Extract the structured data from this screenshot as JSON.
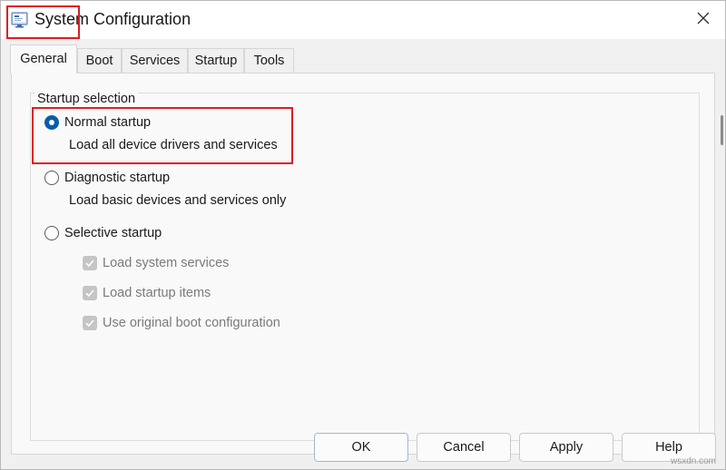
{
  "window": {
    "title": "System Configuration"
  },
  "tabs": [
    {
      "label": "General",
      "active": true
    },
    {
      "label": "Boot",
      "active": false
    },
    {
      "label": "Services",
      "active": false
    },
    {
      "label": "Startup",
      "active": false
    },
    {
      "label": "Tools",
      "active": false
    }
  ],
  "startup_selection": {
    "legend": "Startup selection",
    "normal": {
      "label": "Normal startup",
      "description": "Load all device drivers and services",
      "selected": true
    },
    "diagnostic": {
      "label": "Diagnostic startup",
      "description": "Load basic devices and services only",
      "selected": false
    },
    "selective": {
      "label": "Selective startup",
      "selected": false
    },
    "options": [
      {
        "label": "Load system services",
        "checked": true,
        "enabled": false
      },
      {
        "label": "Load startup items",
        "checked": true,
        "enabled": false
      },
      {
        "label": "Use original boot configuration",
        "checked": true,
        "enabled": false
      }
    ]
  },
  "buttons": {
    "ok": "OK",
    "cancel": "Cancel",
    "apply": "Apply",
    "help": "Help"
  },
  "watermark": "wsxdn.com",
  "colors": {
    "accent": "#0b5cad",
    "highlight": "#e01b22",
    "dialog_bg": "#f0f0f0",
    "panel_bg": "#f9f9f9"
  },
  "icons": {
    "app": "system-config-app-icon",
    "close": "close-icon",
    "check": "checkmark-icon"
  }
}
